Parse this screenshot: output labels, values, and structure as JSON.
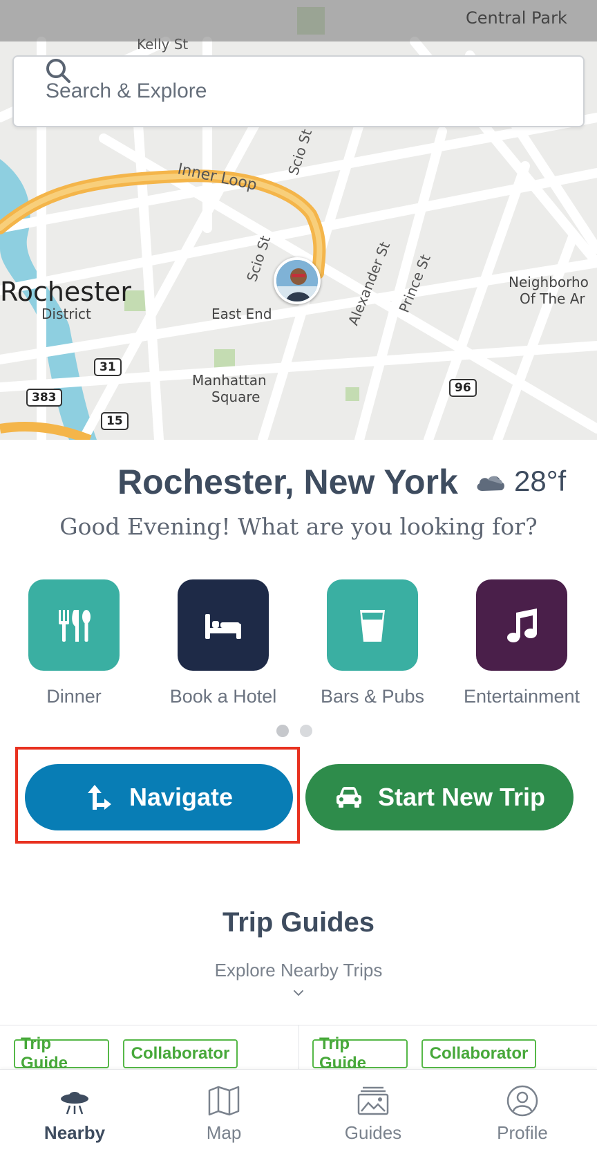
{
  "map": {
    "labels": {
      "central_park": "Central Park",
      "kelly_st": "Kelly St",
      "inner_loop": "Inner Loop",
      "scio_st_upper": "Scio St",
      "scio_st_lower": "Scio St",
      "alexander_st": "Alexander St",
      "prince_st": "Prince St",
      "neighborhood_line1": "Neighborho",
      "neighborhood_line2": "Of The Ar",
      "rochester": "Rochester",
      "district": "District",
      "east_end": "East End",
      "manhattan_line1": "Manhattan",
      "manhattan_line2": "Square",
      "route_31": "31",
      "route_383": "383",
      "route_15": "15",
      "route_96": "96"
    }
  },
  "search": {
    "placeholder": "Search & Explore",
    "icon": "search-icon"
  },
  "location": {
    "city": "Rochester, New York",
    "temperature": "28°f",
    "weather_icon": "cloud-icon",
    "greeting": "Good Evening! What are you looking for?"
  },
  "categories": [
    {
      "label": "Dinner",
      "icon": "utensils-icon",
      "color": "#3aafa2"
    },
    {
      "label": "Book a Hotel",
      "icon": "bed-icon",
      "color": "#1e2a47"
    },
    {
      "label": "Bars & Pubs",
      "icon": "glass-icon",
      "color": "#3aafa2"
    },
    {
      "label": "Entertainment",
      "icon": "music-icon",
      "color": "#4a1f4a"
    }
  ],
  "pager": {
    "pages": 2,
    "current": 1
  },
  "actions": {
    "navigate_label": "Navigate",
    "start_trip_label": "Start New Trip",
    "navigate_color": "#087db5",
    "start_trip_color": "#2e8c4b"
  },
  "guides": {
    "title": "Trip Guides",
    "subtitle": "Explore Nearby Trips",
    "cards": [
      {
        "tags": [
          "Trip Guide",
          "Collaborator"
        ]
      },
      {
        "tags": [
          "Trip Guide",
          "Collaborator"
        ]
      }
    ]
  },
  "nav": {
    "items": [
      {
        "label": "Nearby",
        "icon": "ufo-icon",
        "active": true
      },
      {
        "label": "Map",
        "icon": "map-icon",
        "active": false
      },
      {
        "label": "Guides",
        "icon": "guides-icon",
        "active": false
      },
      {
        "label": "Profile",
        "icon": "profile-icon",
        "active": false
      }
    ]
  }
}
